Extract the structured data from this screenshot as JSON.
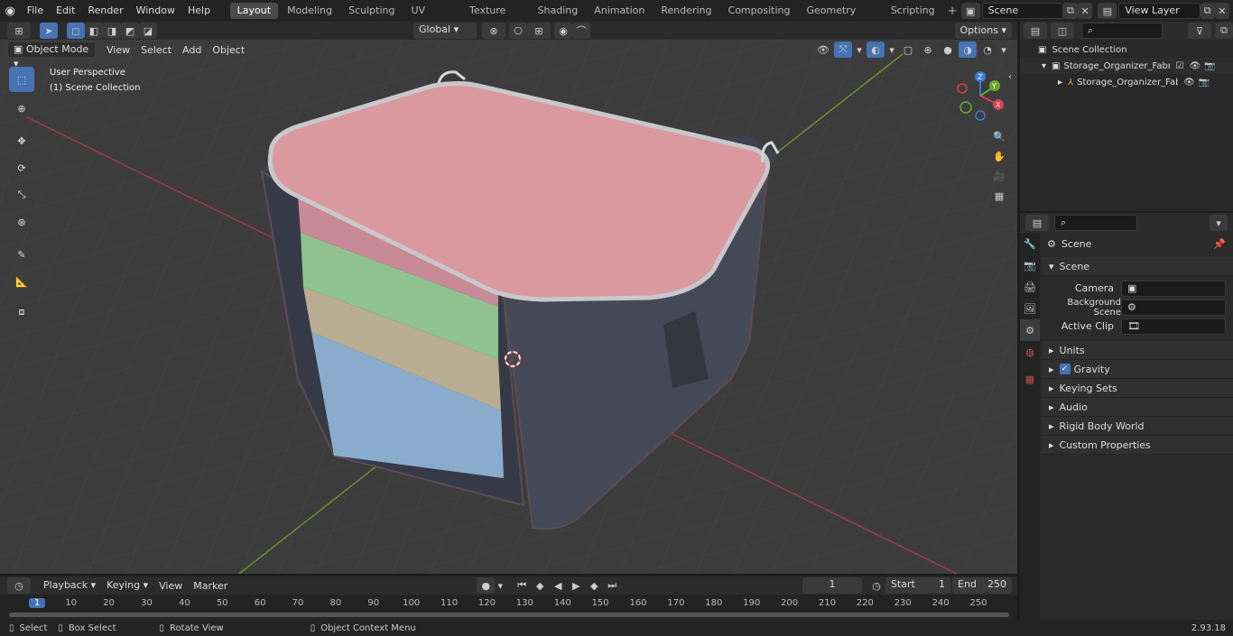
{
  "menus": [
    "File",
    "Edit",
    "Render",
    "Window",
    "Help"
  ],
  "workspaces": [
    "Layout",
    "Modeling",
    "Sculpting",
    "UV Editing",
    "Texture Paint",
    "Shading",
    "Animation",
    "Rendering",
    "Compositing",
    "Geometry Nodes",
    "Scripting"
  ],
  "active_workspace": "Layout",
  "scene_name": "Scene",
  "view_layer": "View Layer",
  "viewport_header": {
    "mode": "Object Mode",
    "view": "View",
    "select": "Select",
    "add": "Add",
    "object": "Object",
    "orientation": "Global",
    "options": "Options"
  },
  "viewport": {
    "perspective": "User Perspective",
    "collection": "(1) Scene Collection"
  },
  "outliner": {
    "root": "Scene Collection",
    "items": [
      "Storage_Organizer_Fabric_Bla",
      "Storage_Organizer_Fabri"
    ]
  },
  "properties": {
    "context": "Scene",
    "section": "Scene",
    "camera_label": "Camera",
    "background_label": "Background Scene",
    "clip_label": "Active Clip",
    "panels": [
      "Units",
      "Gravity",
      "Keying Sets",
      "Audio",
      "Rigid Body World",
      "Custom Properties"
    ]
  },
  "timeline": {
    "playback": "Playback",
    "keying": "Keying",
    "view": "View",
    "marker": "Marker",
    "current_frame": "1",
    "start_label": "Start",
    "start": "1",
    "end_label": "End",
    "end": "250",
    "ticks": [
      "1",
      "10",
      "20",
      "30",
      "40",
      "50",
      "60",
      "70",
      "80",
      "90",
      "100",
      "110",
      "120",
      "130",
      "140",
      "150",
      "160",
      "170",
      "180",
      "190",
      "200",
      "210",
      "220",
      "230",
      "240",
      "250"
    ]
  },
  "statusbar": {
    "select": "Select",
    "box_select": "Box Select",
    "rotate_view": "Rotate View",
    "context_menu": "Object Context Menu",
    "version": "2.93.18"
  }
}
